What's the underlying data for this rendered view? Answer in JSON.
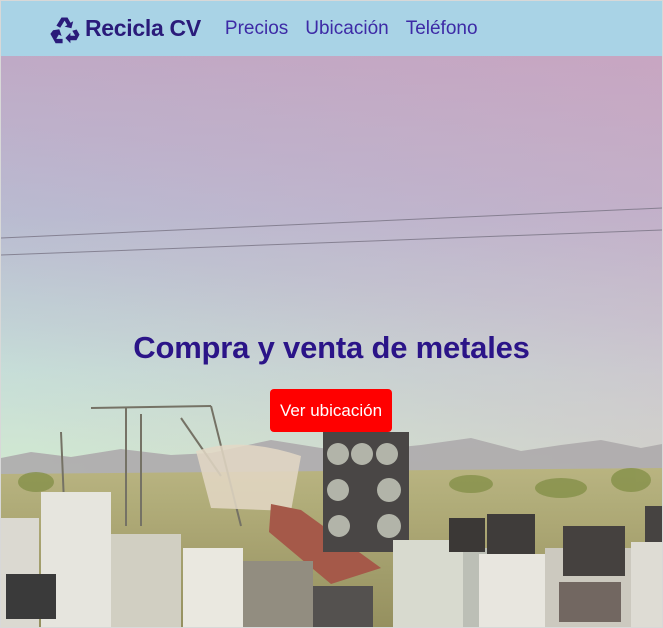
{
  "navbar": {
    "brand_icon": "recycle-icon",
    "brand": "Recicla CV",
    "links": [
      "Precios",
      "Ubicación",
      "Teléfono"
    ]
  },
  "hero": {
    "title": "Compra y venta de metales",
    "button_label": "Ver ubicación"
  },
  "colors": {
    "navbar_bg": "#a9d3e6",
    "brand": "#2a1b7a",
    "link": "#3d2aa6",
    "title": "#2b1488",
    "button": "#ff0000"
  }
}
